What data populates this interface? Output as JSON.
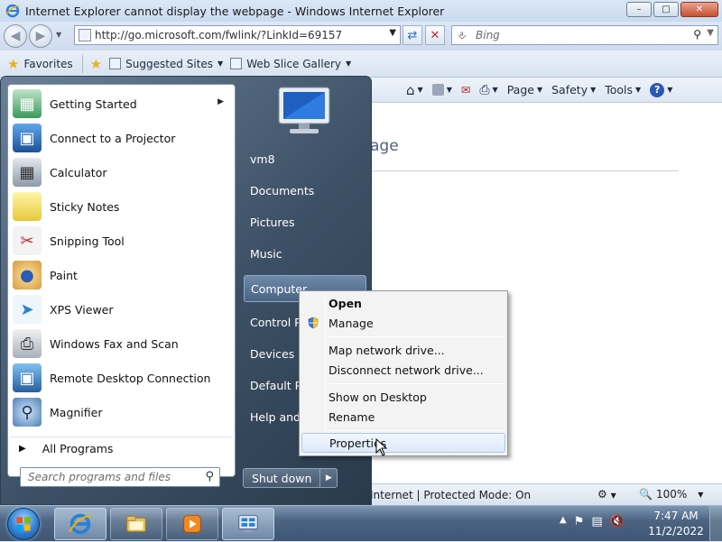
{
  "window": {
    "title": "Internet Explorer cannot display the webpage - Windows Internet Explorer",
    "minimize": "–",
    "maximize": "□",
    "close": "✕"
  },
  "navigation": {
    "address": "http://go.microsoft.com/fwlink/?LinkId=69157",
    "search_placeholder": "Bing"
  },
  "favorites_bar": {
    "favorites_label": "Favorites",
    "items": [
      "Suggested Sites",
      "Web Slice Gallery"
    ]
  },
  "command_bar": {
    "items": [
      "Page",
      "Safety",
      "Tools"
    ]
  },
  "page": {
    "heading_fragment": "age"
  },
  "status_bar": {
    "status": "Internet | Protected Mode: On",
    "zoom": "100%"
  },
  "start_menu": {
    "programs": [
      {
        "label": "Getting Started",
        "icon": "getting-started-icon",
        "has_submenu": true
      },
      {
        "label": "Connect to a Projector",
        "icon": "projector-icon"
      },
      {
        "label": "Calculator",
        "icon": "calculator-icon"
      },
      {
        "label": "Sticky Notes",
        "icon": "sticky-notes-icon"
      },
      {
        "label": "Snipping Tool",
        "icon": "snipping-tool-icon"
      },
      {
        "label": "Paint",
        "icon": "paint-icon"
      },
      {
        "label": "XPS Viewer",
        "icon": "xps-viewer-icon"
      },
      {
        "label": "Windows Fax and Scan",
        "icon": "fax-scan-icon"
      },
      {
        "label": "Remote Desktop Connection",
        "icon": "remote-desktop-icon"
      },
      {
        "label": "Magnifier",
        "icon": "magnifier-icon"
      }
    ],
    "all_programs": "All Programs",
    "search_placeholder": "Search programs and files",
    "right_items": [
      "vm8",
      "Documents",
      "Pictures",
      "Music",
      "Computer",
      "Control Pa",
      "Devices ar",
      "Default Pr",
      "Help and S"
    ],
    "shutdown": "Shut down"
  },
  "context_menu": {
    "items": [
      "Open",
      "Manage",
      "Map network drive...",
      "Disconnect network drive...",
      "Show on Desktop",
      "Rename",
      "Properties"
    ]
  },
  "taskbar": {
    "time": "7:47 AM",
    "date": "11/2/2022"
  }
}
